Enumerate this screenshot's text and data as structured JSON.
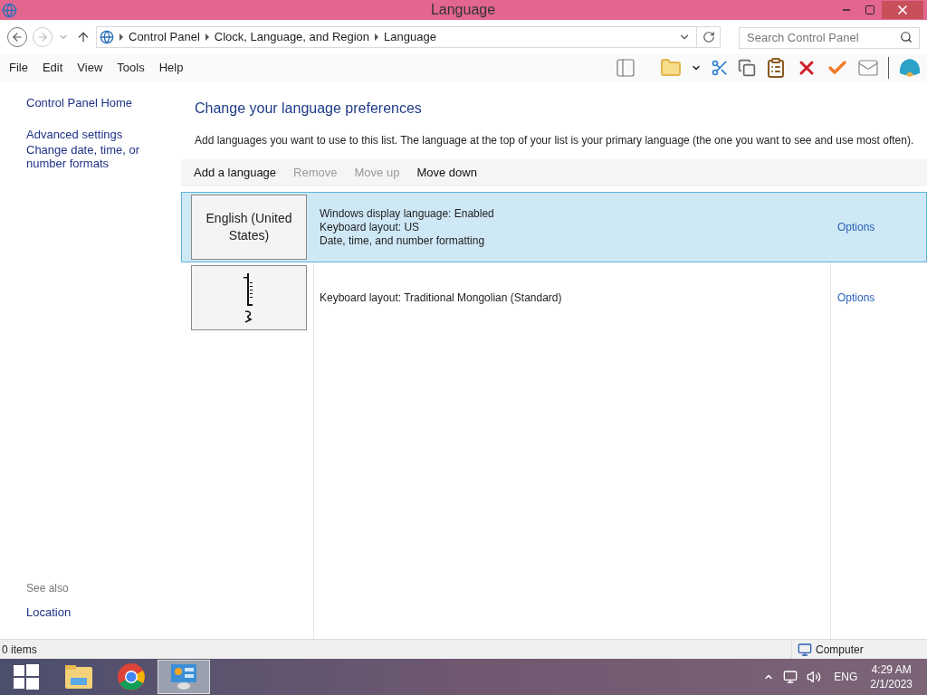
{
  "window": {
    "title": "Language"
  },
  "address": {
    "crumbs": [
      "Control Panel",
      "Clock, Language, and Region",
      "Language"
    ],
    "search_placeholder": "Search Control Panel"
  },
  "menu": [
    "File",
    "Edit",
    "View",
    "Tools",
    "Help"
  ],
  "sidebar": {
    "links": [
      "Control Panel Home",
      "Advanced settings",
      "Change date, time, or number formats"
    ],
    "see_also_title": "See also",
    "see_also": [
      "Location"
    ]
  },
  "heading": "Change your language preferences",
  "description": "Add languages you want to use to this list. The language at the top of your list is your primary language (the one you want to see and use most often).",
  "actions": [
    {
      "label": "Add a language",
      "disabled": false
    },
    {
      "label": "Remove",
      "disabled": true
    },
    {
      "label": "Move up",
      "disabled": true
    },
    {
      "label": "Move down",
      "disabled": false
    }
  ],
  "languages": [
    {
      "kind": "text",
      "tile": "English (United States)",
      "details": [
        "Windows display language: Enabled",
        "Keyboard layout: US",
        "Date, time, and number formatting"
      ],
      "options": "Options",
      "selected": true
    },
    {
      "kind": "script",
      "details": [
        "Keyboard layout: Traditional Mongolian (Standard)"
      ],
      "options": "Options",
      "selected": false
    }
  ],
  "status_bar": {
    "items": "0 items",
    "location": "Computer"
  },
  "taskbar": {
    "apps": [
      {
        "kind": "start",
        "selected": false
      },
      {
        "kind": "explorer",
        "selected": false
      },
      {
        "kind": "chrome",
        "selected": false
      },
      {
        "kind": "control",
        "selected": true
      }
    ],
    "input": "ENG",
    "time": "4:29 AM",
    "date": "2/1/2023"
  }
}
